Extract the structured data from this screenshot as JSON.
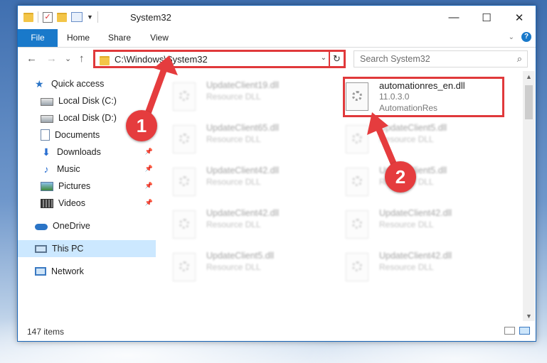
{
  "window": {
    "title": "System32",
    "controls": {
      "minimize": "—",
      "maximize": "☐",
      "close": "✕"
    }
  },
  "ribbon": {
    "tabs": [
      "File",
      "Home",
      "Share",
      "View"
    ]
  },
  "navigation": {
    "back": "←",
    "forward": "→",
    "recent": "⌄",
    "up": "↑",
    "address": "C:\\Windows\\System32",
    "refresh": "↻",
    "search_placeholder": "Search System32",
    "search_icon": "⌕"
  },
  "sidebar": {
    "items": [
      {
        "label": "Quick access",
        "icon": "star-icon"
      },
      {
        "label": "Local Disk (C:)",
        "icon": "drive-icon",
        "pinned": true
      },
      {
        "label": "Local Disk (D:)",
        "icon": "drive-icon",
        "pinned": true
      },
      {
        "label": "Documents",
        "icon": "documents-icon",
        "pinned": true
      },
      {
        "label": "Downloads",
        "icon": "downloads-icon",
        "pinned": true
      },
      {
        "label": "Music",
        "icon": "music-icon",
        "pinned": true
      },
      {
        "label": "Pictures",
        "icon": "pictures-icon",
        "pinned": true
      },
      {
        "label": "Videos",
        "icon": "videos-icon",
        "pinned": true
      },
      {
        "label": "OneDrive",
        "icon": "onedrive-icon"
      },
      {
        "label": "This PC",
        "icon": "this-pc-icon",
        "selected": true
      },
      {
        "label": "Network",
        "icon": "network-icon"
      }
    ]
  },
  "files": {
    "highlighted": {
      "name": "automationres_en.dll",
      "version": "11.0.3.0",
      "description": "AutomationRes"
    },
    "blurred_left": [
      {
        "name": "UpdateClient19.dll",
        "type": "Resource DLL"
      },
      {
        "name": "UpdateClient65.dll",
        "type": "Resource DLL"
      },
      {
        "name": "UpdateClient42.dll",
        "type": "Resource DLL"
      },
      {
        "name": "UpdateClient42.dll",
        "type": "Resource DLL"
      },
      {
        "name": "UpdateClient5.dll",
        "type": "Resource DLL"
      }
    ],
    "blurred_right": [
      {
        "name": "UpdateClient5.dll",
        "type": "Resource DLL"
      },
      {
        "name": "UpdateClient5.dll",
        "type": "Resource DLL"
      },
      {
        "name": "UpdateClient42.dll",
        "type": "Resource DLL"
      },
      {
        "name": "UpdateClient42.dll",
        "type": "Resource DLL"
      }
    ]
  },
  "status": {
    "item_count": "147 items"
  },
  "markers": {
    "one": "1",
    "two": "2"
  },
  "colors": {
    "accent": "#1979ca",
    "highlight": "#e0393b",
    "selected": "#cce8ff"
  }
}
